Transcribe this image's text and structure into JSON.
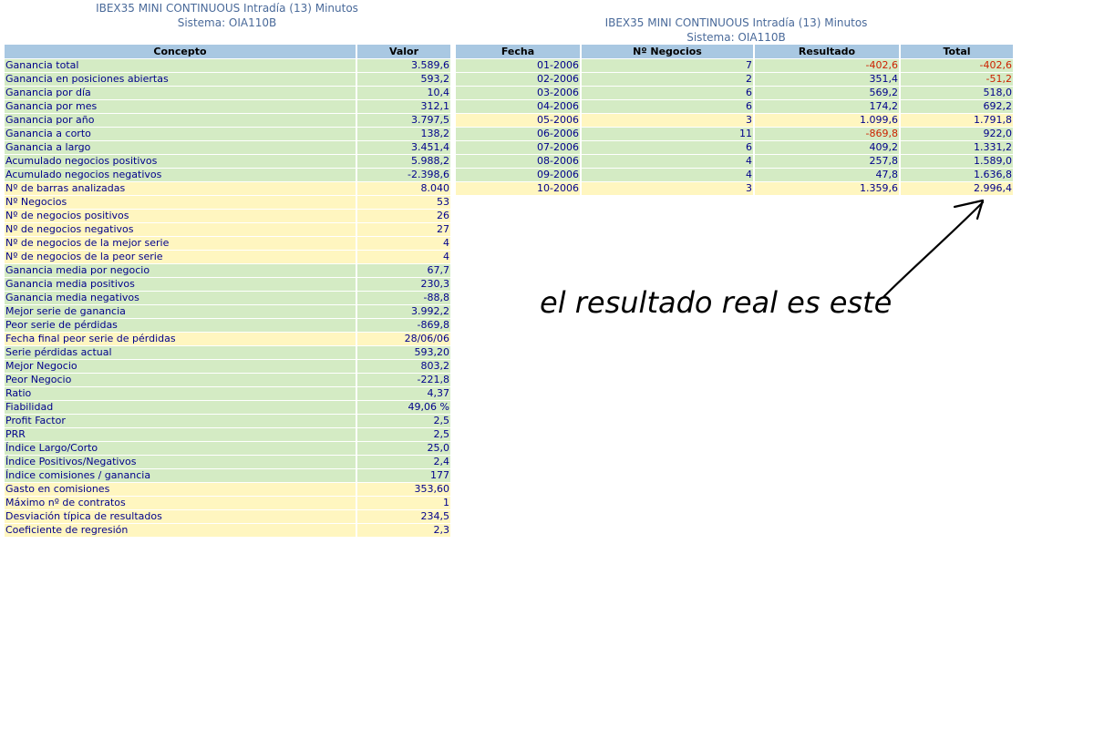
{
  "left_header": {
    "line1": "IBEX35 MINI CONTINUOUS Intradía (13) Minutos",
    "line2": "Sistema: OIA110B"
  },
  "right_header": {
    "line1": "IBEX35 MINI CONTINUOUS Intradía (13) Minutos",
    "line2": "Sistema: OIA110B"
  },
  "stats_table": {
    "headers": [
      "Concepto",
      "Valor"
    ],
    "rows": [
      {
        "c": "Ganancia total",
        "v": "3.589,6",
        "bg": "g"
      },
      {
        "c": "Ganancia en posiciones abiertas",
        "v": "593,2",
        "bg": "g"
      },
      {
        "c": "Ganancia por día",
        "v": "10,4",
        "bg": "g"
      },
      {
        "c": "Ganancia por mes",
        "v": "312,1",
        "bg": "g"
      },
      {
        "c": "Ganancia por año",
        "v": "3.797,5",
        "bg": "g"
      },
      {
        "c": "Ganancia a corto",
        "v": "138,2",
        "bg": "g"
      },
      {
        "c": "Ganancia a largo",
        "v": "3.451,4",
        "bg": "g"
      },
      {
        "c": "Acumulado negocios positivos",
        "v": "5.988,2",
        "bg": "g"
      },
      {
        "c": "Acumulado negocios negativos",
        "v": "-2.398,6",
        "bg": "g"
      },
      {
        "c": "Nº de barras analizadas",
        "v": "8.040",
        "bg": "y"
      },
      {
        "c": "Nº Negocios",
        "v": "53",
        "bg": "y"
      },
      {
        "c": "Nº de negocios positivos",
        "v": "26",
        "bg": "y"
      },
      {
        "c": "Nº de negocios negativos",
        "v": "27",
        "bg": "y"
      },
      {
        "c": "Nº de negocios de la mejor serie",
        "v": "4",
        "bg": "y"
      },
      {
        "c": "Nº de negocios de la peor serie",
        "v": "4",
        "bg": "y"
      },
      {
        "c": "Ganancia media por negocio",
        "v": "67,7",
        "bg": "g"
      },
      {
        "c": "Ganancia media positivos",
        "v": "230,3",
        "bg": "g"
      },
      {
        "c": "Ganancia media negativos",
        "v": "-88,8",
        "bg": "g"
      },
      {
        "c": "Mejor serie de ganancia",
        "v": "3.992,2",
        "bg": "g"
      },
      {
        "c": "Peor serie de pérdidas",
        "v": "-869,8",
        "bg": "g"
      },
      {
        "c": "Fecha final peor serie de pérdidas",
        "v": "28/06/06",
        "bg": "y"
      },
      {
        "c": "Serie pérdidas actual",
        "v": "593,20",
        "bg": "g"
      },
      {
        "c": "Mejor Negocio",
        "v": "803,2",
        "bg": "g"
      },
      {
        "c": "Peor Negocio",
        "v": "-221,8",
        "bg": "g"
      },
      {
        "c": "Ratio",
        "v": "4,37",
        "bg": "g"
      },
      {
        "c": "Fiabilidad",
        "v": "49,06 %",
        "bg": "g"
      },
      {
        "c": "Profit Factor",
        "v": "2,5",
        "bg": "g"
      },
      {
        "c": "PRR",
        "v": "2,5",
        "bg": "g"
      },
      {
        "c": "Índice Largo/Corto",
        "v": "25,0",
        "bg": "g"
      },
      {
        "c": "Índice Positivos/Negativos",
        "v": "2,4",
        "bg": "g"
      },
      {
        "c": "Índice comisiones / ganancia",
        "v": "177",
        "bg": "g"
      },
      {
        "c": "Gasto en comisiones",
        "v": "353,60",
        "bg": "y"
      },
      {
        "c": "Máximo nº de contratos",
        "v": "1",
        "bg": "y"
      },
      {
        "c": "Desviación típica de resultados",
        "v": "234,5",
        "bg": "y"
      },
      {
        "c": "Coeficiente de regresión",
        "v": "2,3",
        "bg": "y"
      }
    ]
  },
  "monthly_table": {
    "headers": [
      "Fecha",
      "Nº Negocios",
      "Resultado",
      "Total"
    ],
    "rows": [
      {
        "fecha": "01-2006",
        "n": "7",
        "res": "-402,6",
        "res_neg": true,
        "total": "-402,6",
        "total_neg": true,
        "bg": "g"
      },
      {
        "fecha": "02-2006",
        "n": "2",
        "res": "351,4",
        "res_neg": false,
        "total": "-51,2",
        "total_neg": true,
        "bg": "g"
      },
      {
        "fecha": "03-2006",
        "n": "6",
        "res": "569,2",
        "res_neg": false,
        "total": "518,0",
        "total_neg": false,
        "bg": "g"
      },
      {
        "fecha": "04-2006",
        "n": "6",
        "res": "174,2",
        "res_neg": false,
        "total": "692,2",
        "total_neg": false,
        "bg": "g"
      },
      {
        "fecha": "05-2006",
        "n": "3",
        "res": "1.099,6",
        "res_neg": false,
        "total": "1.791,8",
        "total_neg": false,
        "bg": "y"
      },
      {
        "fecha": "06-2006",
        "n": "11",
        "res": "-869,8",
        "res_neg": true,
        "total": "922,0",
        "total_neg": false,
        "bg": "g"
      },
      {
        "fecha": "07-2006",
        "n": "6",
        "res": "409,2",
        "res_neg": false,
        "total": "1.331,2",
        "total_neg": false,
        "bg": "g"
      },
      {
        "fecha": "08-2006",
        "n": "4",
        "res": "257,8",
        "res_neg": false,
        "total": "1.589,0",
        "total_neg": false,
        "bg": "g"
      },
      {
        "fecha": "09-2006",
        "n": "4",
        "res": "47,8",
        "res_neg": false,
        "total": "1.636,8",
        "total_neg": false,
        "bg": "g"
      },
      {
        "fecha": "10-2006",
        "n": "3",
        "res": "1.359,6",
        "res_neg": false,
        "total": "2.996,4",
        "total_neg": false,
        "bg": "y"
      }
    ]
  },
  "annotation": {
    "text": "el resultado real es este"
  },
  "colors": {
    "header_bg": "#a9c8e2",
    "row_green": "#d4ebc4",
    "row_yellow": "#fff6c0",
    "text_blue": "#00008b",
    "negative_red": "#cc2200"
  }
}
